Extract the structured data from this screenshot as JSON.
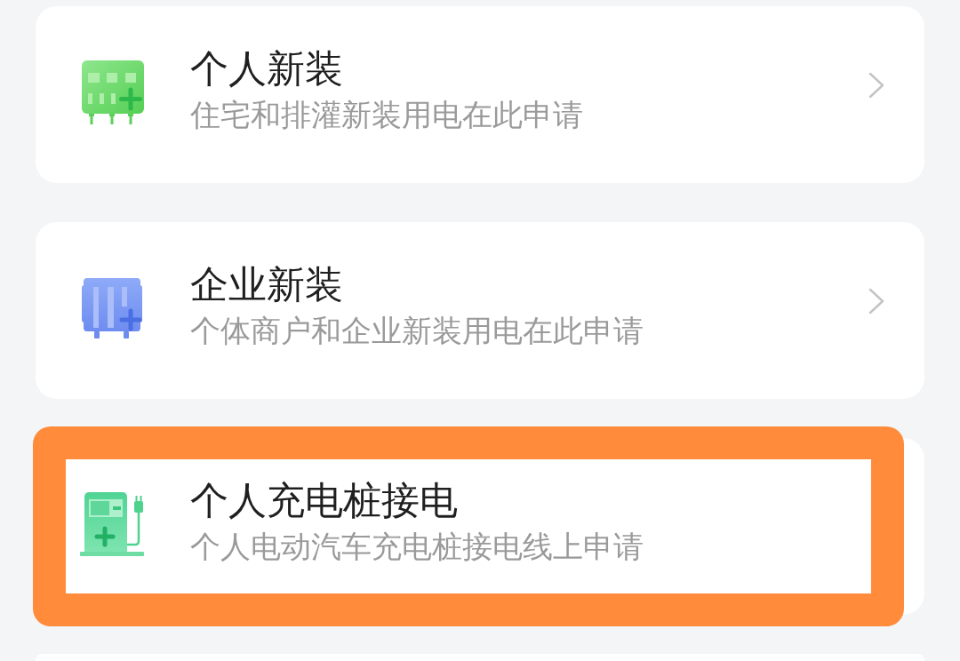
{
  "items": [
    {
      "title": "个人新装",
      "subtitle": "住宅和排灌新装用电在此申请",
      "chevron": true,
      "highlighted": false
    },
    {
      "title": "企业新装",
      "subtitle": "个体商户和企业新装用电在此申请",
      "chevron": true,
      "highlighted": false
    },
    {
      "title": "个人充电桩接电",
      "subtitle": "个人电动汽车充电桩接电线上申请",
      "chevron": false,
      "highlighted": true
    }
  ]
}
